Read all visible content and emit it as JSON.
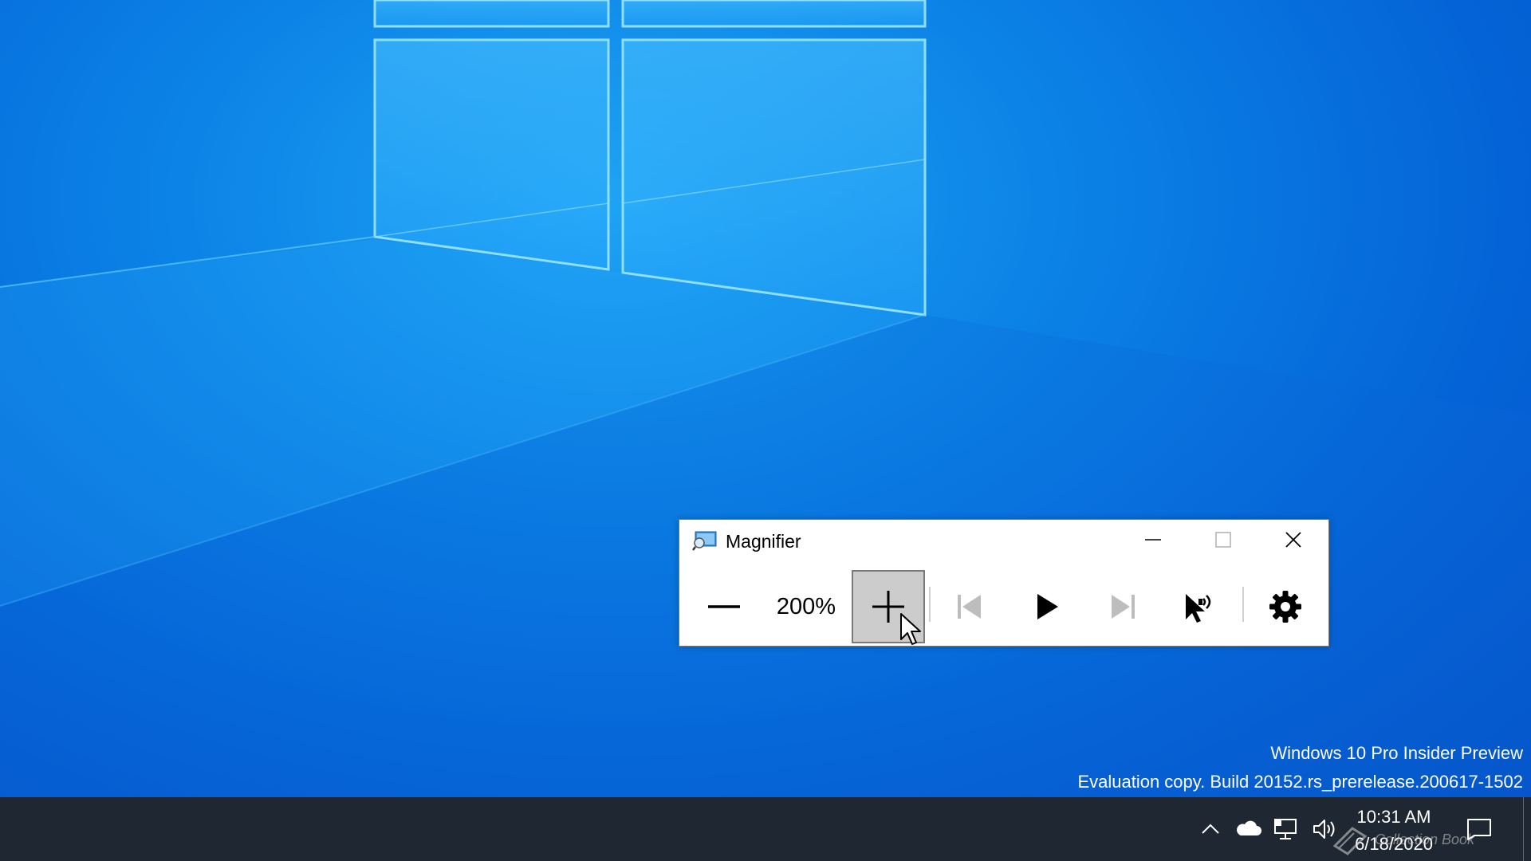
{
  "desktop": {
    "watermark": {
      "line1": "Windows 10 Pro Insider Preview",
      "line2": "Evaluation copy. Build 20152.rs_prerelease.200617-1502"
    }
  },
  "magnifier": {
    "title": "Magnifier",
    "icon": "magnifier-app-icon",
    "caption_buttons": [
      "minimize-icon",
      "maximize-icon",
      "close-icon"
    ],
    "zoom_level": "200%",
    "toolbar": [
      {
        "name": "zoom-out",
        "icon": "minus-icon"
      },
      {
        "name": "zoom-in",
        "icon": "plus-icon",
        "state": "pressed"
      },
      {
        "name": "read-previous",
        "icon": "skip-back-icon",
        "enabled": false
      },
      {
        "name": "read-play",
        "icon": "play-icon"
      },
      {
        "name": "read-next",
        "icon": "skip-forward-icon",
        "enabled": false
      },
      {
        "name": "read-from-pointer",
        "icon": "pointer-speaker-icon"
      },
      {
        "name": "settings",
        "icon": "gear-icon"
      }
    ]
  },
  "taskbar": {
    "tray_icons": [
      "chevron-up-icon",
      "onedrive-cloud-icon",
      "network-icon",
      "volume-icon"
    ],
    "clock": {
      "time": "10:31 AM",
      "date": "6/18/2020"
    },
    "notification_icon": "action-center-icon",
    "overlay_logo_text": "Collection Book"
  },
  "colors": {
    "desktop_blue": "#0b82e6",
    "taskbar": "#1f2832",
    "pressed_button": "#cccccc"
  }
}
